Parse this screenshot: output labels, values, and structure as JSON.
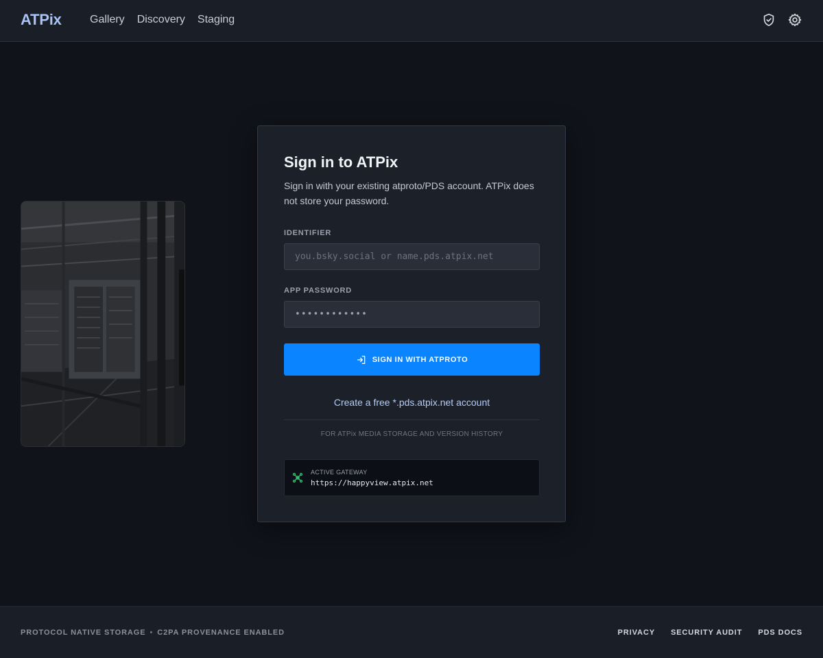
{
  "header": {
    "brand": "ATPix",
    "nav": [
      "Gallery",
      "Discovery",
      "Staging"
    ],
    "icons": [
      "shield-check-icon",
      "gear-icon"
    ]
  },
  "side_image": {
    "icon": "server-room-image"
  },
  "login": {
    "title": "Sign in to ATPix",
    "subtitle": "Sign in with your existing atproto/PDS account. ATPix does not store your password.",
    "identifier_label": "IDENTIFIER",
    "identifier_placeholder": "you.bsky.social or name.pds.atpix.net",
    "identifier_value": "",
    "password_label": "APP PASSWORD",
    "password_value": "••••••••••••",
    "signin_label": "SIGN IN WITH ATPROTO",
    "create_link": "Create a free *.pds.atpix.net account",
    "storage_note": "FOR ATPix MEDIA STORAGE AND VERSION HISTORY",
    "gateway_label": "ACTIVE GATEWAY",
    "gateway_url": "https://happyview.atpix.net"
  },
  "footer": {
    "left_a": "PROTOCOL NATIVE STORAGE",
    "separator": "•",
    "left_b": "C2PA PROVENANCE ENABLED",
    "links": [
      "PRIVACY",
      "SECURITY AUDIT",
      "PDS DOCS"
    ]
  },
  "colors": {
    "accent": "#0a84ff",
    "brand": "#a9c3f5",
    "gateway_icon": "#2fbf71",
    "background": "#10131a"
  }
}
